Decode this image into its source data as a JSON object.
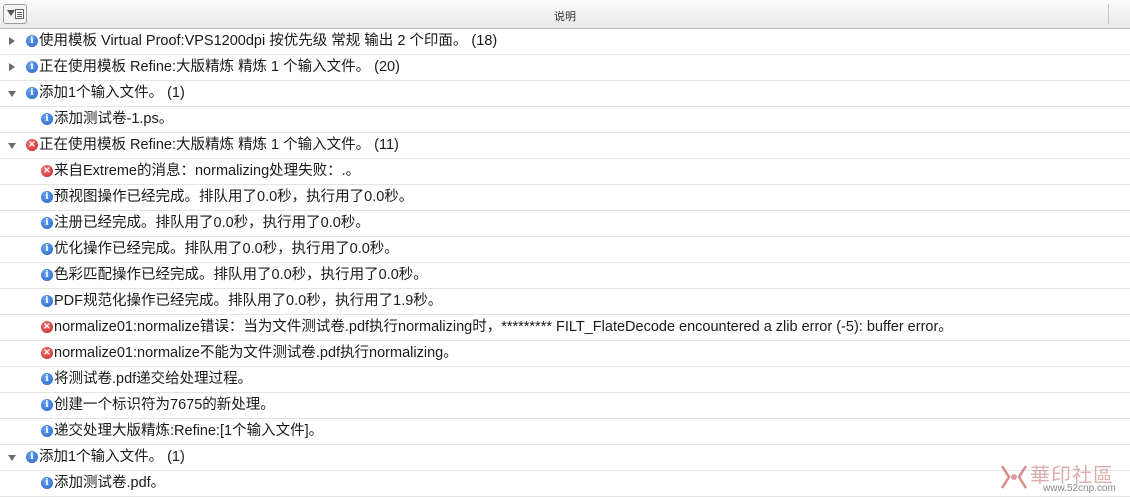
{
  "header": {
    "column_title": "说明"
  },
  "log_rows": [
    {
      "level": 0,
      "expander": "collapsed",
      "icon": "info-icon",
      "text": "使用模板 Virtual Proof:VPS1200dpi 按优先级 常规 输出 2 个印面。 (18)"
    },
    {
      "level": 0,
      "expander": "collapsed",
      "icon": "info-icon",
      "text": "正在使用模板 Refine:大版精炼 精炼 1 个输入文件。 (20)"
    },
    {
      "level": 0,
      "expander": "expanded",
      "icon": "info-icon",
      "text": "添加1个输入文件。 (1)"
    },
    {
      "level": 1,
      "expander": "none",
      "icon": "info-icon",
      "text": "添加测试卷-1.ps。"
    },
    {
      "level": 0,
      "expander": "expanded",
      "icon": "error-icon",
      "text": "正在使用模板 Refine:大版精炼 精炼 1 个输入文件。 (11)"
    },
    {
      "level": 1,
      "expander": "none",
      "icon": "error-icon",
      "text": "来自Extreme的消息：normalizing处理失败：.。"
    },
    {
      "level": 1,
      "expander": "none",
      "icon": "info-icon",
      "text": "预视图操作已经完成。排队用了0.0秒，执行用了0.0秒。"
    },
    {
      "level": 1,
      "expander": "none",
      "icon": "info-icon",
      "text": "注册已经完成。排队用了0.0秒，执行用了0.0秒。"
    },
    {
      "level": 1,
      "expander": "none",
      "icon": "info-icon",
      "text": "优化操作已经完成。排队用了0.0秒，执行用了0.0秒。"
    },
    {
      "level": 1,
      "expander": "none",
      "icon": "info-icon",
      "text": "色彩匹配操作已经完成。排队用了0.0秒，执行用了0.0秒。"
    },
    {
      "level": 1,
      "expander": "none",
      "icon": "info-icon",
      "text": "PDF规范化操作已经完成。排队用了0.0秒，执行用了1.9秒。"
    },
    {
      "level": 1,
      "expander": "none",
      "icon": "error-icon",
      "text": "normalize01:normalize错误：当为文件测试卷.pdf执行normalizing时，********* FILT_FlateDecode encountered a zlib error (-5): buffer error。"
    },
    {
      "level": 1,
      "expander": "none",
      "icon": "error-icon",
      "text": "normalize01:normalize不能为文件测试卷.pdf执行normalizing。"
    },
    {
      "level": 1,
      "expander": "none",
      "icon": "info-icon",
      "text": "将测试卷.pdf递交给处理过程。"
    },
    {
      "level": 1,
      "expander": "none",
      "icon": "info-icon",
      "text": "创建一个标识符为7675的新处理。"
    },
    {
      "level": 1,
      "expander": "none",
      "icon": "info-icon",
      "text": "递交处理大版精炼:Refine:[1个输入文件]。"
    },
    {
      "level": 0,
      "expander": "expanded",
      "icon": "info-icon",
      "text": "添加1个输入文件。 (1)"
    },
    {
      "level": 1,
      "expander": "none",
      "icon": "info-icon",
      "text": "添加测试卷.pdf。"
    }
  ],
  "icons": {
    "info": "i",
    "error": "×"
  },
  "colors": {
    "info": "#1f5fc4",
    "error": "#c71c1c"
  },
  "watermark": {
    "title": "華印社區",
    "url": "www.52cnp.com"
  }
}
